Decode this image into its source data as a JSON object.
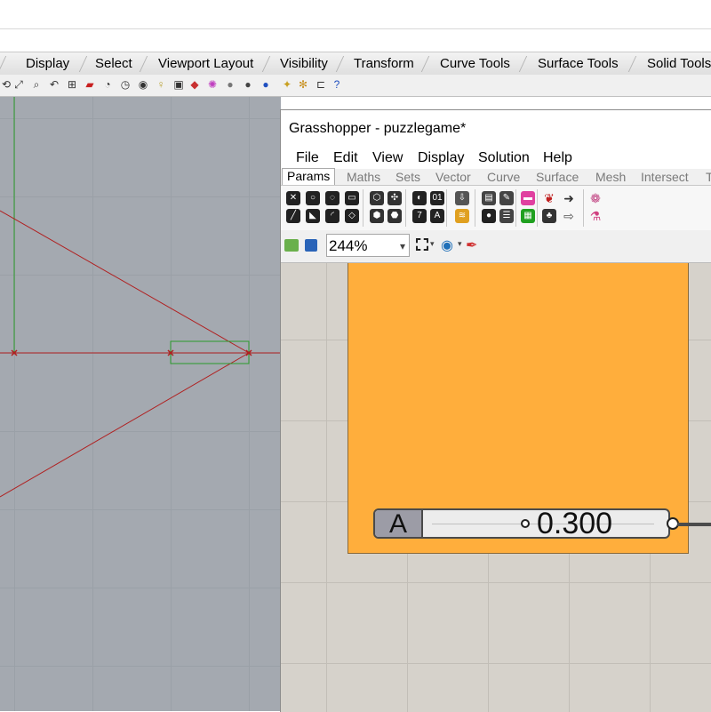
{
  "rhino": {
    "tabs": [
      {
        "label": "Display"
      },
      {
        "label": "Select"
      },
      {
        "label": "Viewport Layout"
      },
      {
        "label": "Visibility"
      },
      {
        "label": "Transform"
      },
      {
        "label": "Curve Tools"
      },
      {
        "label": "Surface Tools"
      },
      {
        "label": "Solid Tools"
      }
    ],
    "viewport": {
      "background": "#a4a9b0",
      "axis_x_color": "#b02020",
      "axis_y_color": "#2a9a2a"
    }
  },
  "grasshopper": {
    "title": "Grasshopper - puzzlegame*",
    "menu": [
      "File",
      "Edit",
      "View",
      "Display",
      "Solution",
      "Help"
    ],
    "tabs": [
      "Params",
      "Maths",
      "Sets",
      "Vector",
      "Curve",
      "Surface",
      "Mesh",
      "Intersect",
      "T"
    ],
    "active_tab": "Params",
    "zoom": "244%",
    "group_color": "#ffae3c",
    "slider": {
      "label": "A",
      "value": "0.300",
      "fraction": 0.3
    }
  }
}
